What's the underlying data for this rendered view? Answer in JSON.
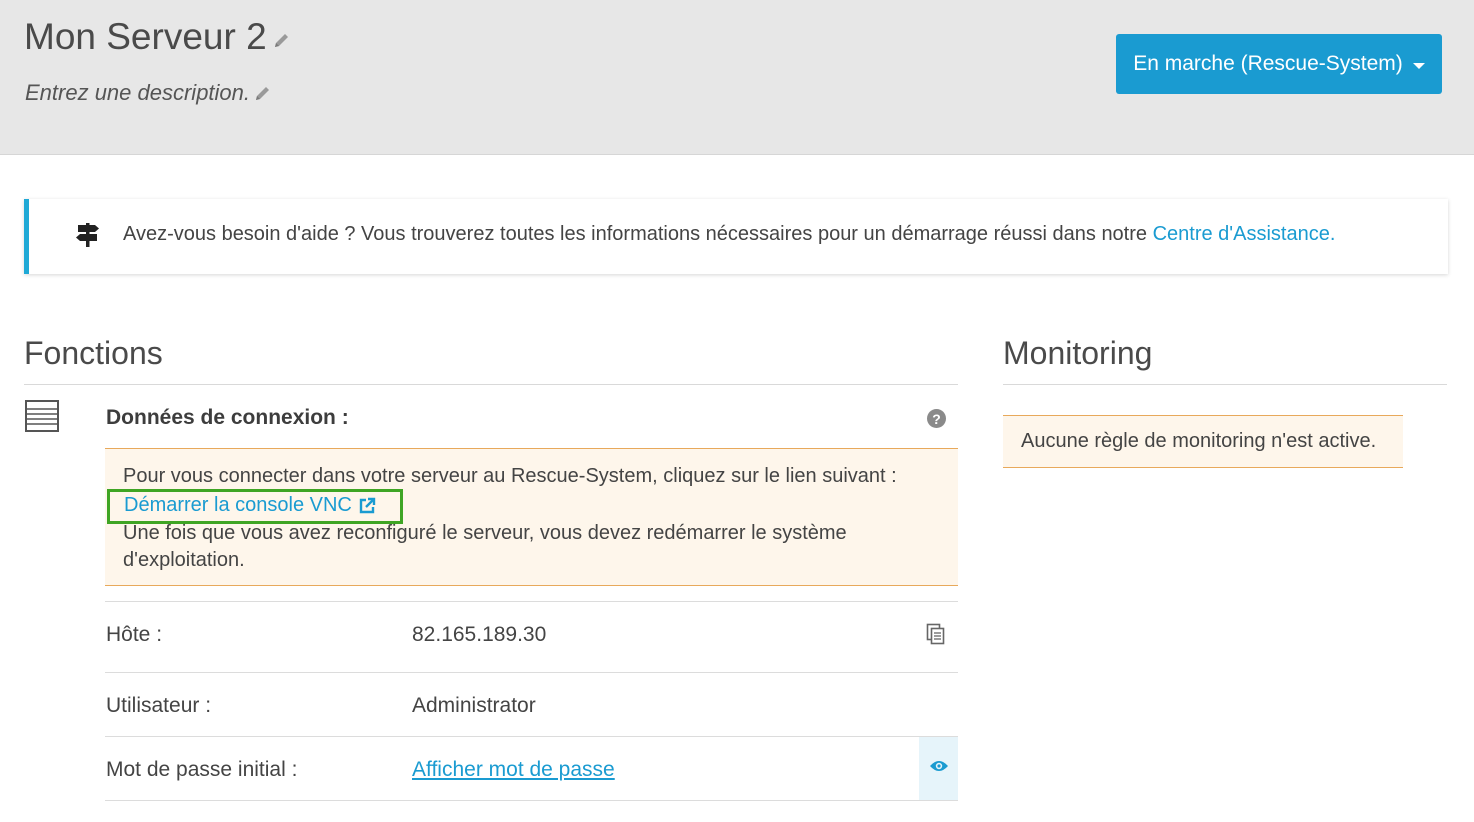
{
  "header": {
    "title": "Mon Serveur 2",
    "description": "Entrez une description.",
    "status_button": "En marche (Rescue-System)",
    "accent_color": "#1a9bd1"
  },
  "help_banner": {
    "text": "Avez-vous besoin d'aide ? Vous trouverez toutes les informations nécessaires pour un démarrage réussi dans notre ",
    "link": "Centre d'Assistance.",
    "icon": "signpost-icon"
  },
  "fonctions": {
    "title": "Fonctions",
    "connection": {
      "title": "Données de connexion :",
      "notice_line1": "Pour vous connecter dans votre serveur au Rescue-System, cliquez sur le lien suivant :",
      "vnc_link": "Démarrer la console VNC",
      "notice_line2": "Une fois que vous avez reconfiguré le serveur, vous devez redémarrer le système d'exploitation.",
      "rows": [
        {
          "label": "Hôte :",
          "value": "82.165.189.30"
        },
        {
          "label": "Utilisateur :",
          "value": "Administrator"
        },
        {
          "label": "Mot de passe initial :",
          "value": "Afficher mot de passe"
        }
      ]
    }
  },
  "monitoring": {
    "title": "Monitoring",
    "empty_message": "Aucune règle de monitoring n'est active."
  }
}
